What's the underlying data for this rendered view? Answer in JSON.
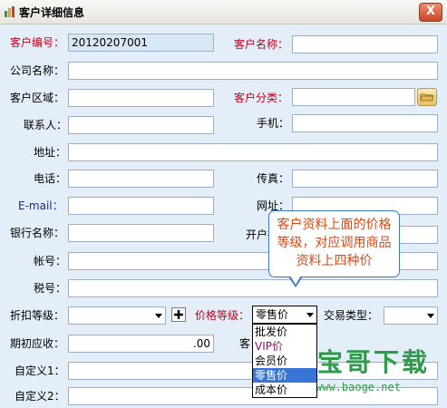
{
  "window": {
    "title": "客户详细信息",
    "close_glyph": "X"
  },
  "fields": {
    "customer_no": {
      "label": "客户编号：",
      "value": "20120207001"
    },
    "customer_name": {
      "label": "客户名称：",
      "value": ""
    },
    "company_name": {
      "label": "公司名称：",
      "value": ""
    },
    "region": {
      "label": "客户区域：",
      "value": ""
    },
    "category": {
      "label": "客户分类：",
      "value": ""
    },
    "contact": {
      "label": "联系人：",
      "value": ""
    },
    "mobile": {
      "label": "手机：",
      "value": ""
    },
    "address": {
      "label": "地址：",
      "value": ""
    },
    "phone": {
      "label": "电话：",
      "value": ""
    },
    "fax": {
      "label": "传真：",
      "value": ""
    },
    "email": {
      "label": "E-mail：",
      "value": ""
    },
    "website": {
      "label": "网址：",
      "value": ""
    },
    "bank_name": {
      "label": "银行名称：",
      "value": ""
    },
    "bank_branch": {
      "label": "开户行：",
      "value": ""
    },
    "account": {
      "label": "帐号：",
      "value": ""
    },
    "tax_no": {
      "label": "税号：",
      "value": ""
    },
    "discount_level": {
      "label": "折扣等级：",
      "value": ""
    },
    "price_level": {
      "label": "价格等级：",
      "value": "零售价"
    },
    "trade_type": {
      "label": "交易类型：",
      "value": ""
    },
    "opening_receivable": {
      "label": "期初应收：",
      "value": ".00"
    },
    "partial_label": "客",
    "custom1": {
      "label": "自定义1：",
      "value": ""
    },
    "custom2": {
      "label": "自定义2：",
      "value": ""
    }
  },
  "price_options": [
    "批发价",
    "VIP价",
    "会员价",
    "零售价",
    "成本价"
  ],
  "price_selected": "零售价",
  "tooltip": {
    "text": "客户资料上面的价格等级，对应调用商品资料上四种价"
  },
  "watermark": {
    "main": "宝哥下载",
    "url": "www.baoge.net"
  },
  "colors": {
    "required_label": "#c4001c",
    "form_bg": "#e3eef9",
    "selected_option": "#3875d7",
    "tooltip_text": "#d64a16",
    "watermark": "#2e9a4a"
  },
  "icons": {
    "title": "app-window-icon",
    "plus": "add-icon",
    "picker": "folder-picker-icon"
  }
}
